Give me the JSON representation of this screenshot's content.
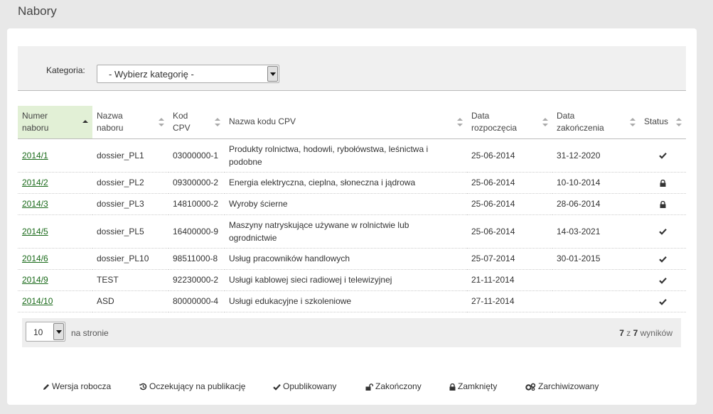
{
  "page": {
    "title": "Nabory"
  },
  "filter": {
    "label": "Kategoria:",
    "selected": "- Wybierz kategorię -"
  },
  "table": {
    "headers": [
      {
        "line1": "Numer",
        "line2": "naboru",
        "sort": "asc"
      },
      {
        "line1": "Nazwa",
        "line2": "naboru",
        "sort": "both"
      },
      {
        "line1": "Kod",
        "line2": "CPV",
        "sort": "both"
      },
      {
        "line1": "Nazwa kodu CPV",
        "line2": "",
        "sort": "both"
      },
      {
        "line1": "Data",
        "line2": "rozpoczęcia",
        "sort": "both"
      },
      {
        "line1": "Data",
        "line2": "zakończenia",
        "sort": "both"
      },
      {
        "line1": "Status",
        "line2": "",
        "sort": "both"
      }
    ],
    "rows": [
      {
        "numer": "2014/1",
        "nazwa": "dossier_PL1",
        "kod": "03000000-1",
        "cpv": "Produkty rolnictwa, hodowli, rybołówstwa, leśnictwa i podobne",
        "start": "25-06-2014",
        "end": "31-12-2020",
        "status": "check-icon"
      },
      {
        "numer": "2014/2",
        "nazwa": "dossier_PL2",
        "kod": "09300000-2",
        "cpv": "Energia elektryczna, cieplna, słoneczna i jądrowa",
        "start": "25-06-2014",
        "end": "10-10-2014",
        "status": "lock-icon"
      },
      {
        "numer": "2014/3",
        "nazwa": "dossier_PL3",
        "kod": "14810000-2",
        "cpv": "Wyroby ścierne",
        "start": "25-06-2014",
        "end": "28-06-2014",
        "status": "lock-icon"
      },
      {
        "numer": "2014/5",
        "nazwa": "dossier_PL5",
        "kod": "16400000-9",
        "cpv": "Maszyny natryskujące używane w rolnictwie lub ogrodnictwie",
        "start": "25-06-2014",
        "end": "14-03-2021",
        "status": "check-icon"
      },
      {
        "numer": "2014/6",
        "nazwa": "dossier_PL10",
        "kod": "98511000-8",
        "cpv": "Usług pracowników handlowych",
        "start": "25-07-2014",
        "end": "30-01-2015",
        "status": "check-icon"
      },
      {
        "numer": "2014/9",
        "nazwa": "TEST",
        "kod": "92230000-2",
        "cpv": "Usługi kablowej sieci radiowej i telewizyjnej",
        "start": "21-11-2014",
        "end": "",
        "status": "check-icon"
      },
      {
        "numer": "2014/10",
        "nazwa": "ASD",
        "kod": "80000000-4",
        "cpv": "Usługi edukacyjne i szkoleniowe",
        "start": "27-11-2014",
        "end": "",
        "status": "check-icon"
      }
    ]
  },
  "pagination": {
    "per_page": "10",
    "per_page_label": "na stronie",
    "shown": "7",
    "of_word": "z",
    "total": "7",
    "results_word": "wyników"
  },
  "legend": [
    {
      "icon": "pencil-icon",
      "label": "Wersja robocza"
    },
    {
      "icon": "history-icon",
      "label": "Oczekujący na publikację"
    },
    {
      "icon": "check-icon",
      "label": "Opublikowany"
    },
    {
      "icon": "unlock-icon",
      "label": "Zakończony"
    },
    {
      "icon": "lock-icon",
      "label": "Zamknięty"
    },
    {
      "icon": "cogs-icon",
      "label": "Zarchiwizowany"
    }
  ]
}
